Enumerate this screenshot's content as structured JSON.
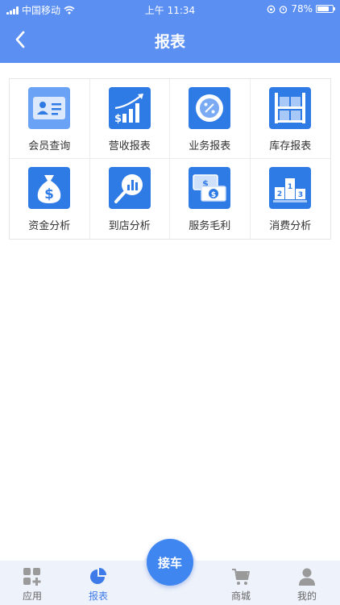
{
  "status_bar": {
    "carrier": "中国移动",
    "time": "上午 11:34",
    "battery": "78%",
    "battery_level": 0.78
  },
  "header": {
    "title": "报表",
    "back_icon": "chevron-left-icon"
  },
  "grid": [
    {
      "label": "会员查询",
      "icon": "member-card-icon"
    },
    {
      "label": "营收报表",
      "icon": "revenue-chart-icon"
    },
    {
      "label": "业务报表",
      "icon": "percent-icon"
    },
    {
      "label": "库存报表",
      "icon": "warehouse-shelf-icon"
    },
    {
      "label": "资金分析",
      "icon": "money-bag-icon"
    },
    {
      "label": "到店分析",
      "icon": "magnifier-chart-icon"
    },
    {
      "label": "服务毛利",
      "icon": "banknotes-icon"
    },
    {
      "label": "消费分析",
      "icon": "podium-icon"
    }
  ],
  "tabbar": {
    "tabs": [
      {
        "label": "应用",
        "icon": "apps-grid-icon"
      },
      {
        "label": "报表",
        "icon": "pie-chart-icon",
        "active": true
      },
      {
        "label": "商城",
        "icon": "shopping-cart-icon"
      },
      {
        "label": "我的",
        "icon": "user-icon"
      }
    ],
    "center_button": "接车"
  },
  "colors": {
    "header": "#5b8ff2",
    "accent": "#3f86f0",
    "tile_blue": "#2f7be6",
    "tile_light": "#6aa3f5"
  }
}
